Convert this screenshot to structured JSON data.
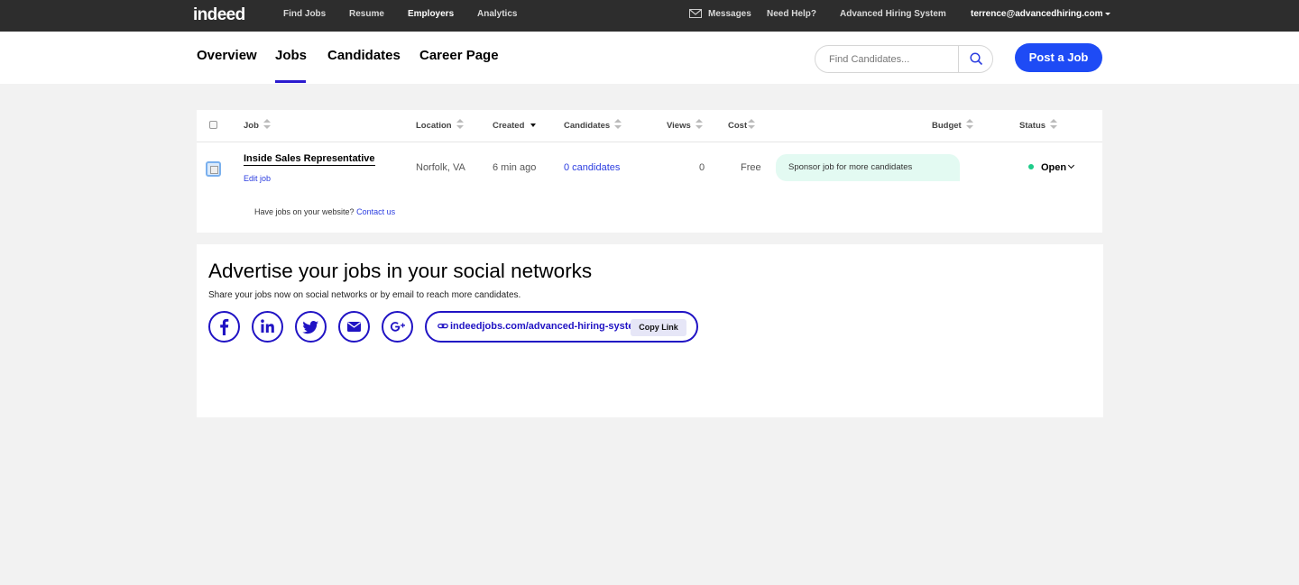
{
  "topbar": {
    "logo": "indeed",
    "nav": [
      "Find Jobs",
      "Resume",
      "Employers",
      "Analytics"
    ],
    "messages": "Messages",
    "help": "Need Help?",
    "company": "Advanced Hiring System",
    "user": "terrence@advancedhiring.com"
  },
  "subnav": {
    "tabs": [
      "Overview",
      "Jobs",
      "Candidates",
      "Career Page"
    ],
    "active_tab": "Jobs",
    "search_placeholder": "Find Candidates...",
    "post_button": "Post a Job"
  },
  "table": {
    "headers": {
      "job": "Job",
      "location": "Location",
      "created": "Created",
      "candidates": "Candidates",
      "views": "Views",
      "cost": "Cost",
      "budget": "Budget",
      "status": "Status"
    },
    "rows": [
      {
        "title": "Inside Sales Representative",
        "edit": "Edit job",
        "location": "Norfolk, VA",
        "created": "6 min ago",
        "candidates": "0 candidates",
        "views": "0",
        "cost": "Free",
        "sponsor": "Sponsor job for more candidates",
        "status": "Open"
      }
    ],
    "footer_text": "Have jobs on your website?",
    "footer_link": "Contact us"
  },
  "advertise": {
    "title": "Advertise your jobs in your social networks",
    "subtitle": "Share your jobs now on social networks or by email to reach more candidates.",
    "networks": [
      "facebook",
      "linkedin",
      "twitter",
      "email",
      "google-plus"
    ],
    "share_url": "indeedjobs.com/advanced-hiring-system",
    "copy_button": "Copy Link"
  },
  "colors": {
    "topbar_bg": "#2d2d2d",
    "primary_blue": "#1e4bf5",
    "social_indigo": "#2013c4",
    "link_blue": "#2b3de0",
    "status_green": "#1ecc8a",
    "sponsor_bg": "#e3faf2"
  }
}
